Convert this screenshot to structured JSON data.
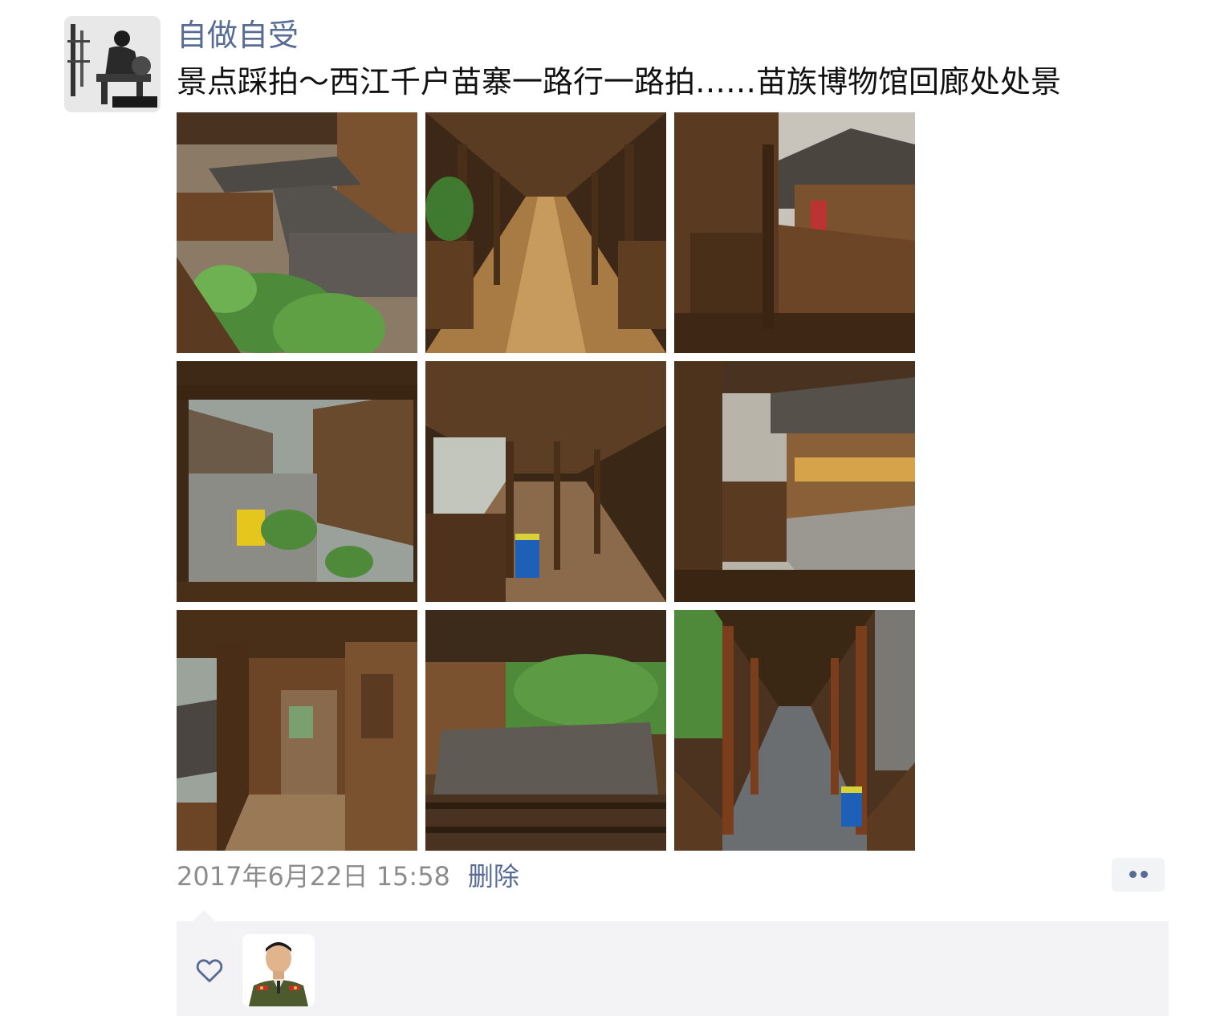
{
  "post": {
    "author": "自做自受",
    "text": "景点踩拍～西江千户苗寨一路行一路拍……苗族博物馆回廊处处景",
    "timestamp": "2017年6月22日 15:58",
    "delete_label": "删除",
    "photo_count": 9,
    "more_icon": "more-dots-icon"
  },
  "likes": {
    "icon": "heart-outline-icon",
    "count": 1
  },
  "colors": {
    "link": "#576b95",
    "text": "#111111",
    "meta": "#8c8c8c",
    "likes_bg": "#f3f3f5",
    "wood": "#6b4526"
  }
}
